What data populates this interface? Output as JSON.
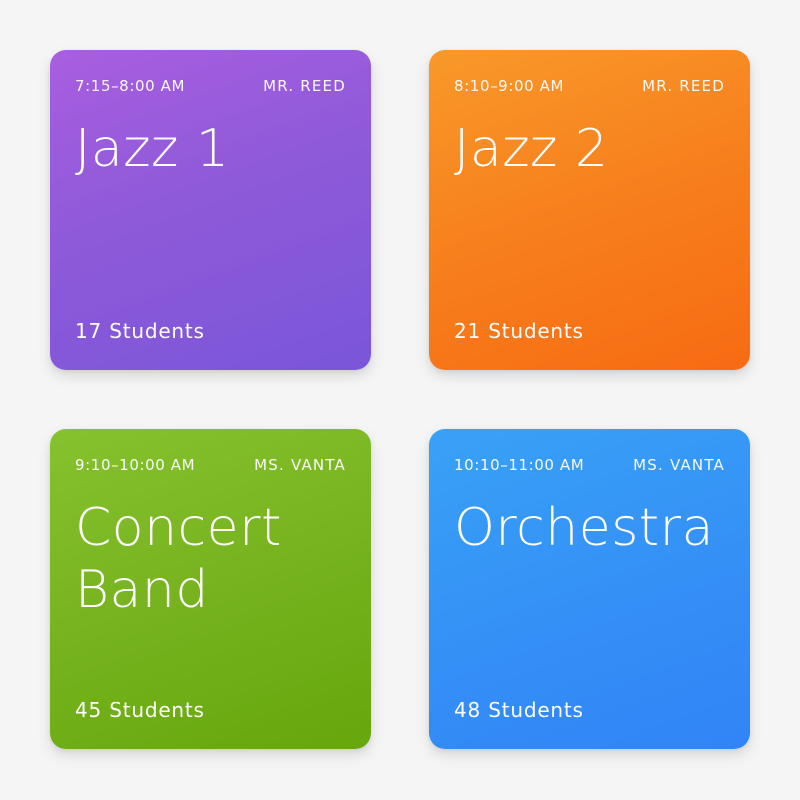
{
  "classes": [
    {
      "time": "7:15–8:00 AM",
      "teacher": "MR. REED",
      "title": "Jazz 1",
      "students": "17 Students",
      "color": "#8e5ad9"
    },
    {
      "time": "8:10–9:00 AM",
      "teacher": "MR. REED",
      "title": "Jazz 2",
      "students": "21 Students",
      "color": "#f77f1d"
    },
    {
      "time": "9:10–10:00 AM",
      "teacher": "MS. VANTA",
      "title": "Concert Band",
      "students": "45 Students",
      "color": "#76b31f"
    },
    {
      "time": "10:10–11:00 AM",
      "teacher": "MS. VANTA",
      "title": "Orchestra",
      "students": "48 Students",
      "color": "#3591f6"
    }
  ]
}
